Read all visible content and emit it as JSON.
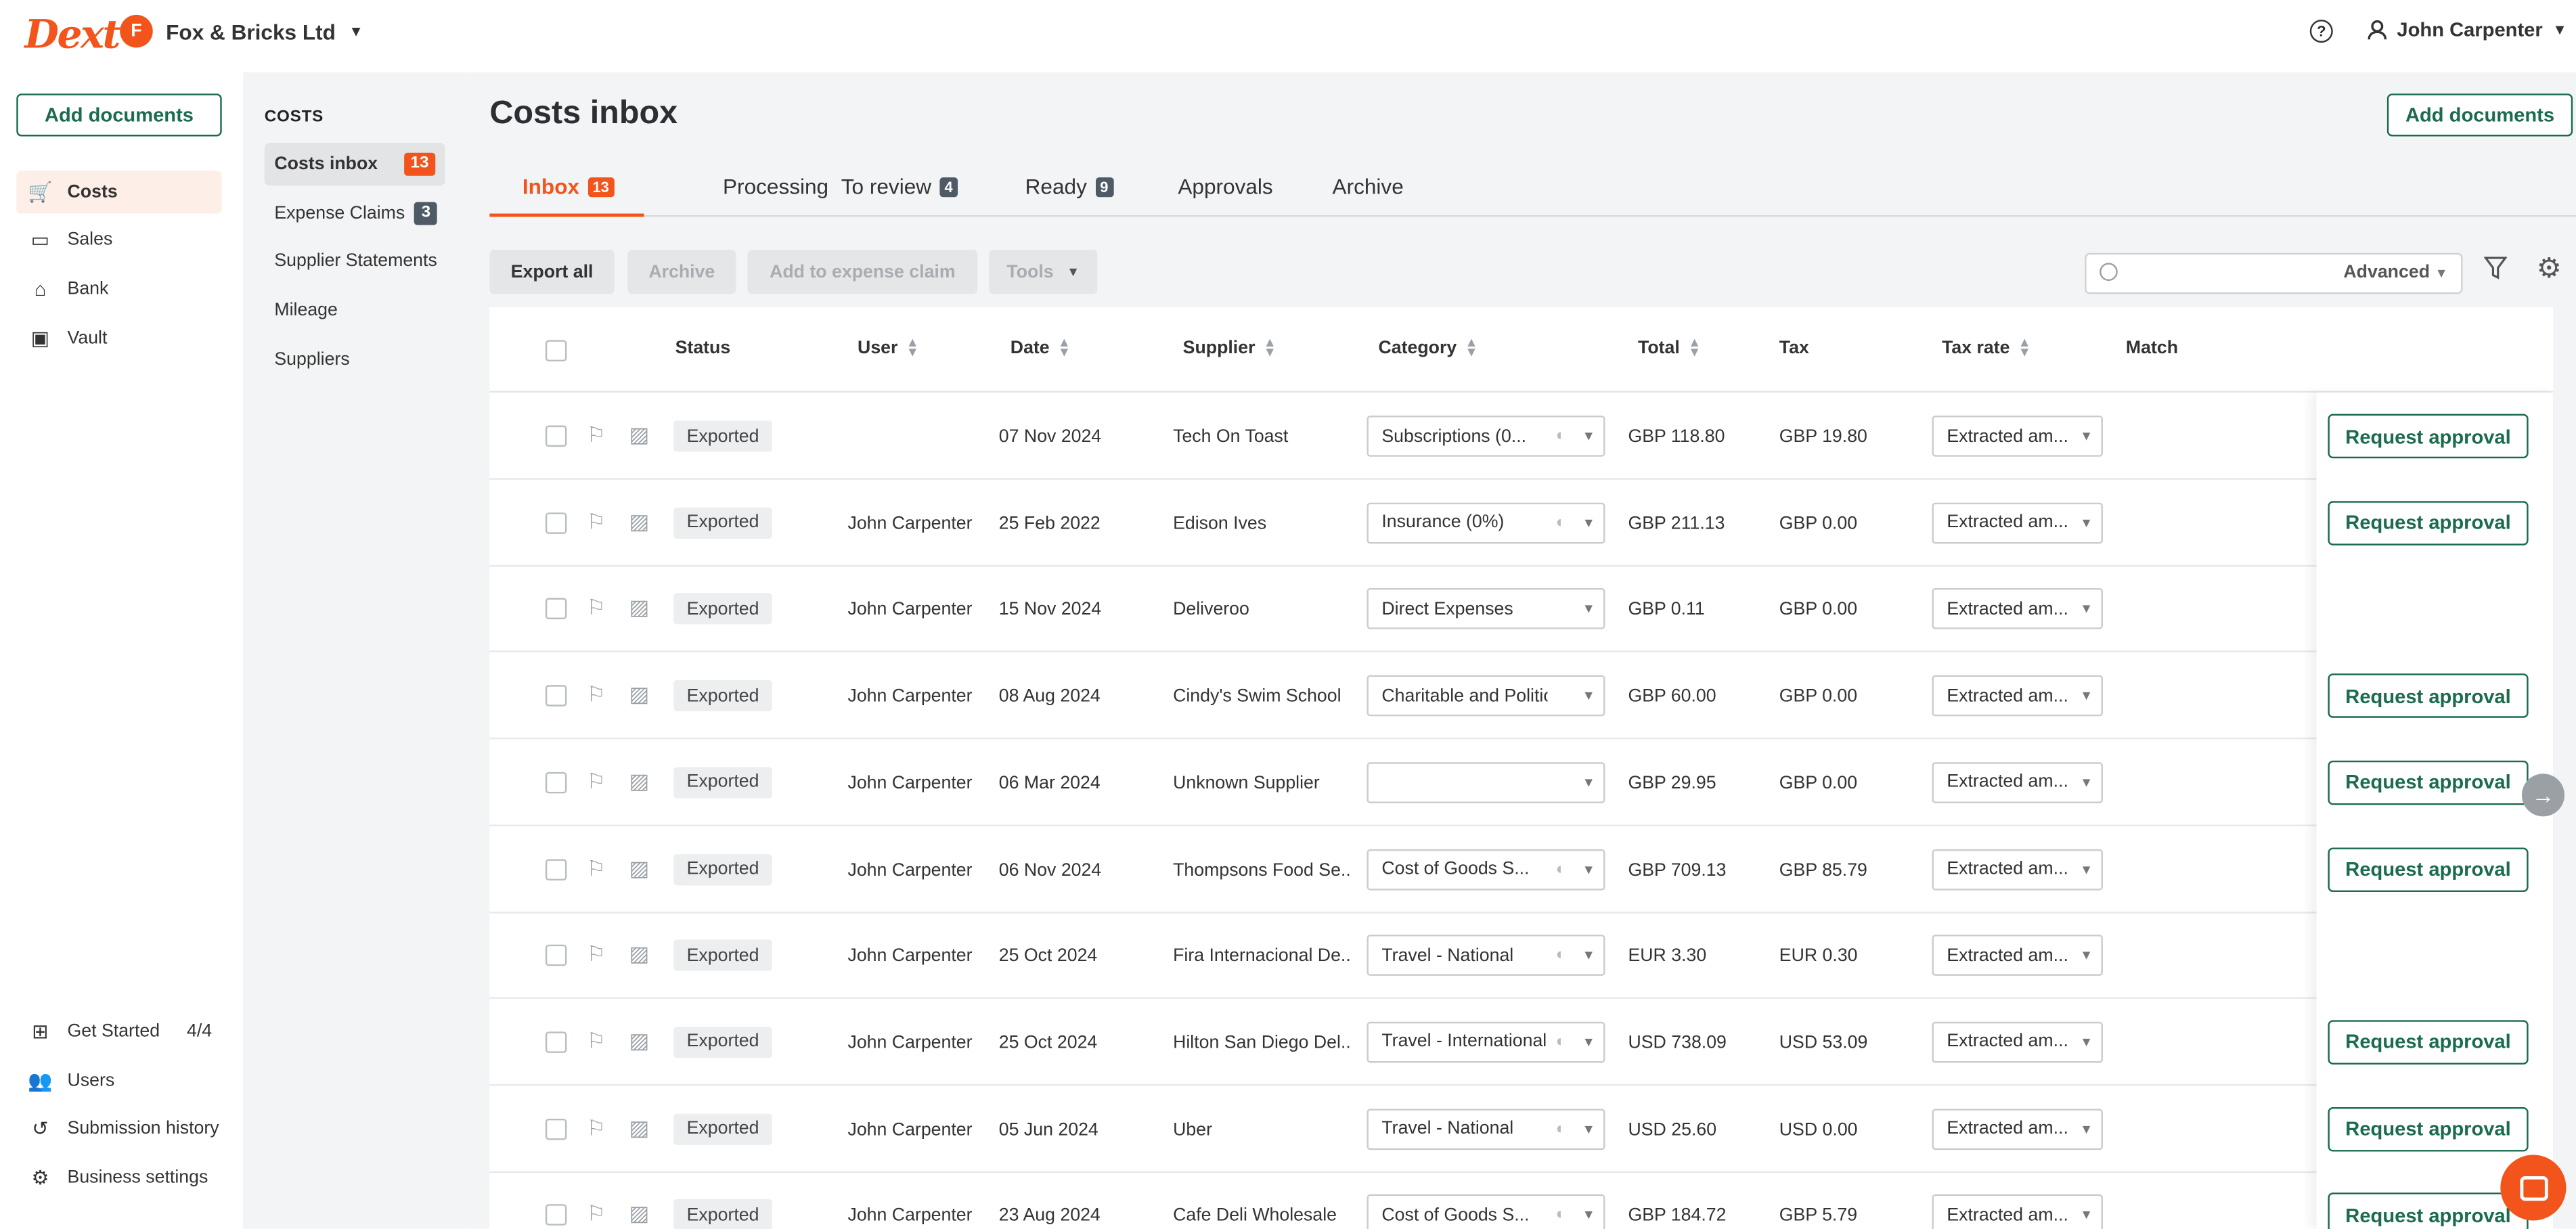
{
  "app": {
    "logo": "Dext",
    "org_initial": "F",
    "org_name": "Fox & Bricks Ltd",
    "help_icon": "?",
    "user_name": "John Carpenter"
  },
  "leftnav": {
    "add_documents": "Add documents",
    "items": [
      {
        "label": "Costs",
        "icon": "cart-icon"
      },
      {
        "label": "Sales",
        "icon": "card-icon"
      },
      {
        "label": "Bank",
        "icon": "bank-icon"
      },
      {
        "label": "Vault",
        "icon": "vault-icon"
      }
    ],
    "bottom": [
      {
        "label": "Get Started",
        "count": "4/4"
      },
      {
        "label": "Users"
      },
      {
        "label": "Submission history"
      },
      {
        "label": "Business settings"
      }
    ]
  },
  "subnav": {
    "heading": "COSTS",
    "items": [
      {
        "label": "Costs inbox",
        "badge": "13"
      },
      {
        "label": "Expense Claims",
        "badge": "3"
      },
      {
        "label": "Supplier Statements"
      },
      {
        "label": "Mileage"
      },
      {
        "label": "Suppliers"
      }
    ]
  },
  "main": {
    "title": "Costs inbox",
    "add_documents": "Add documents",
    "tabs": [
      {
        "label": "Inbox",
        "badge": "13"
      },
      {
        "label": "Processing"
      },
      {
        "label": "To review",
        "badge": "4"
      },
      {
        "label": "Ready",
        "badge": "9"
      },
      {
        "label": "Approvals"
      },
      {
        "label": "Archive"
      }
    ],
    "toolbar": {
      "export_all": "Export all",
      "archive": "Archive",
      "add_to_expense_claim": "Add to expense claim",
      "tools": "Tools"
    },
    "search": {
      "placeholder": "",
      "advanced": "Advanced"
    }
  },
  "table": {
    "headers": {
      "status": "Status",
      "user": "User",
      "date": "Date",
      "supplier": "Supplier",
      "category": "Category",
      "total": "Total",
      "tax": "Tax",
      "tax_rate": "Tax rate",
      "match": "Match"
    },
    "request_label": "Request approval",
    "rows": [
      {
        "status": "Exported",
        "user": "",
        "date": "07 Nov 2024",
        "supplier": "Tech On Toast",
        "category": "Subscriptions (0...",
        "total": "GBP 118.80",
        "tax": "GBP 19.80",
        "tax_rate": "Extracted am...",
        "request": true
      },
      {
        "status": "Exported",
        "user": "John Carpenter",
        "date": "25 Feb 2022",
        "supplier": "Edison Ives",
        "category": "Insurance (0%)",
        "total": "GBP 211.13",
        "tax": "GBP 0.00",
        "tax_rate": "Extracted am...",
        "request": true
      },
      {
        "status": "Exported",
        "user": "John Carpenter",
        "date": "15 Nov 2024",
        "supplier": "Deliveroo",
        "category": "Direct Expenses",
        "total": "GBP 0.11",
        "tax": "GBP 0.00",
        "tax_rate": "Extracted am...",
        "request": false
      },
      {
        "status": "Exported",
        "user": "John Carpenter",
        "date": "08 Aug 2024",
        "supplier": "Cindy's Swim School",
        "category": "Charitable and Politic...",
        "total": "GBP 60.00",
        "tax": "GBP 0.00",
        "tax_rate": "Extracted am...",
        "request": true
      },
      {
        "status": "Exported",
        "user": "John Carpenter",
        "date": "06 Mar 2024",
        "supplier": "Unknown Supplier",
        "category": "",
        "total": "GBP 29.95",
        "tax": "GBP 0.00",
        "tax_rate": "Extracted am...",
        "request": true
      },
      {
        "status": "Exported",
        "user": "John Carpenter",
        "date": "06 Nov 2024",
        "supplier": "Thompsons Food Se...",
        "category": "Cost of Goods S...",
        "total": "GBP 709.13",
        "tax": "GBP 85.79",
        "tax_rate": "Extracted am...",
        "request": true
      },
      {
        "status": "Exported",
        "user": "John Carpenter",
        "date": "25 Oct 2024",
        "supplier": "Fira Internacional De...",
        "category": "Travel - National",
        "total": "EUR 3.30",
        "tax": "EUR 0.30",
        "tax_rate": "Extracted am...",
        "request": false
      },
      {
        "status": "Exported",
        "user": "John Carpenter",
        "date": "25 Oct 2024",
        "supplier": "Hilton San Diego Del...",
        "category": "Travel - International ...",
        "total": "USD 738.09",
        "tax": "USD 53.09",
        "tax_rate": "Extracted am...",
        "request": true
      },
      {
        "status": "Exported",
        "user": "John Carpenter",
        "date": "05 Jun 2024",
        "supplier": "Uber",
        "category": "Travel - National",
        "total": "USD 25.60",
        "tax": "USD 0.00",
        "tax_rate": "Extracted am...",
        "request": true
      },
      {
        "status": "Exported",
        "user": "John Carpenter",
        "date": "23 Aug 2024",
        "supplier": "Cafe Deli Wholesale",
        "category": "Cost of Goods S...",
        "total": "GBP 184.72",
        "tax": "GBP 5.79",
        "tax_rate": "Extracted am...",
        "request": true
      }
    ]
  },
  "colors": {
    "brand": "#f2541b",
    "primary": "#1b6b4d",
    "sidebar_bg": "#f3f4f5"
  }
}
